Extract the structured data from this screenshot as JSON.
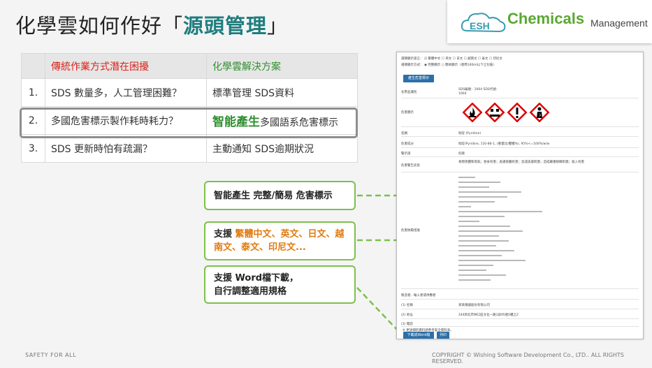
{
  "title": {
    "main": "化學雲如何作好「",
    "highlight": "源頭管理",
    "end": "」"
  },
  "logo": {
    "esh": "ESH",
    "brand": "Chemicals",
    "sub": "Management"
  },
  "table": {
    "headers": [
      "傳統作業方式潛在困擾",
      "化學雲解決方案"
    ],
    "rows": [
      {
        "num": "1.",
        "problem": "SDS 數量多，人工管理困難？",
        "solution": "標準管理 SDS資料"
      },
      {
        "num": "2.",
        "problem": "多國危害標示製作耗時耗力？",
        "solution_bold": "智能產生",
        "solution_rest": "多國語系危害標示"
      },
      {
        "num": "3.",
        "problem": "SDS 更新時怕有疏漏？",
        "solution": "主動通知 SDS逾期狀況"
      }
    ]
  },
  "callouts": {
    "c1": "智能產生 完整/簡易 危害標示",
    "c2_prefix": "支援",
    "c2_langs": "繁體中文、英文、日文、越南文、泰文、印尼文...",
    "c3_line1": "支援 Word檔下載，",
    "c3_line2": "自行調整適用規格"
  },
  "sheet": {
    "lang_label": "選擇顯示語言：",
    "langs": [
      "繁體中文",
      "英文",
      "日文",
      "越南文",
      "泰文",
      "印尼文"
    ],
    "mode_label": "選擇顯示方式：",
    "modes": [
      "完整顯示",
      "簡易顯示（適用100ml以下之包裝）"
    ],
    "gen_button": "產生危害標示",
    "chem_id_label": "化學品識別",
    "chem_id_value": "SDS編號：1004  SDS代號：1004",
    "pictogram_label": "危害圖示",
    "name_label": "名稱",
    "name_value": "吡啶 (Pyridine)",
    "component_label": "危害成分",
    "component_value": "吡啶/Pyridine, 110-86-1, (重量比/體積%), 95%<=100%/w/w",
    "signal_label": "警示語",
    "signal_value": "危險",
    "hazard_label": "危害警告訊息",
    "hazard_value": "易燃液體和蒸氣；吞食有害；皮膚接觸有害；造成皮膚刺激；造成嚴重眼睛刺激；吸入有害",
    "precaution_label": "危害防範措施",
    "supplier_label": "製造者、輸入者或供應者",
    "supplier_name_label": "(1) 名稱",
    "supplier_name_value": "某某儀器股份有限公司",
    "supplier_addr_label": "(2) 地址",
    "supplier_addr_value": "244新北市林口區文化一路1段95號5樓之2",
    "supplier_tel_label": "(3) 電話",
    "note": "※ 更詳細的資料請參考安全資料表。",
    "download_button": "下載成Word檔",
    "print_button": "列印"
  },
  "footer": {
    "left": "SAFETY FOR ALL",
    "right": "COPYRIGHT © Wishing Software Development Co., LTD.. ALL RIGHTS RESERVED."
  },
  "colors": {
    "accent": "#1f7d7e",
    "callout_border": "#7cc04b",
    "problem": "#d9231d",
    "solution": "#2f8f2f",
    "button": "#2c6fa8"
  }
}
